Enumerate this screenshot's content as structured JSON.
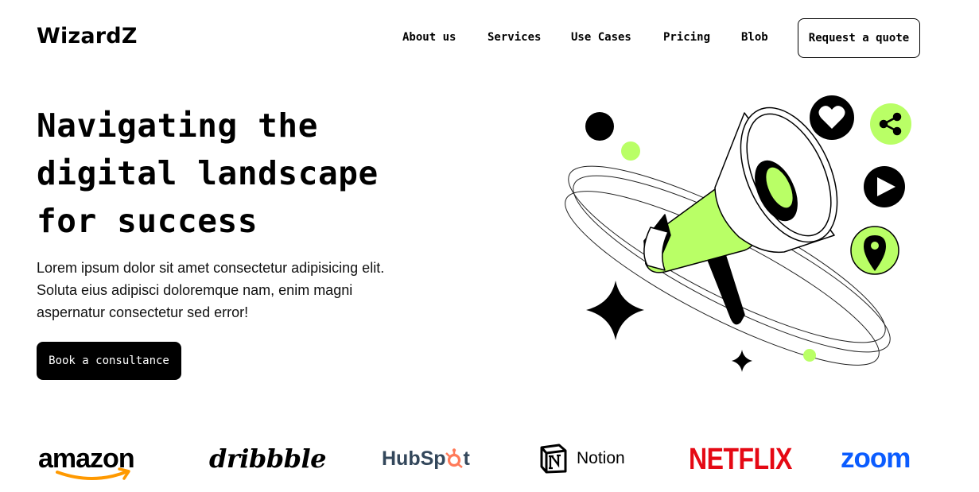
{
  "header": {
    "logo": "WizardZ",
    "nav": [
      "About us",
      "Services",
      "Use Cases",
      "Pricing",
      "Blob"
    ],
    "cta_label": "Request a quote"
  },
  "hero": {
    "title_lines": [
      "Navigating the",
      "digital landscape",
      "for success"
    ],
    "description_lines": [
      "Lorem ipsum dolor sit amet consectetur adipisicing elit.",
      "Soluta eius adipisci doloremque nam, enim magni",
      "aspernatur consectetur sed error!"
    ],
    "cta_label": "Book a consultance"
  },
  "illustration": {
    "icons": [
      "megaphone-icon",
      "heart-icon",
      "share-icon",
      "play-icon",
      "location-pin-icon",
      "sparkle-icon"
    ],
    "accent_color": "#b9ff66"
  },
  "brands": {
    "amazon": "amazon",
    "dribbble": "dribbble",
    "hubspot_prefix": "HubSp",
    "hubspot_suffix": "t",
    "notion": "Notion",
    "netflix": "NETFLIX",
    "zoom": "zoom"
  },
  "colors": {
    "accent": "#b9ff66",
    "hubspot_orange": "#ff7a59",
    "amazon_orange": "#ff9900",
    "netflix_red": "#e50914",
    "zoom_blue": "#0b5cff"
  }
}
